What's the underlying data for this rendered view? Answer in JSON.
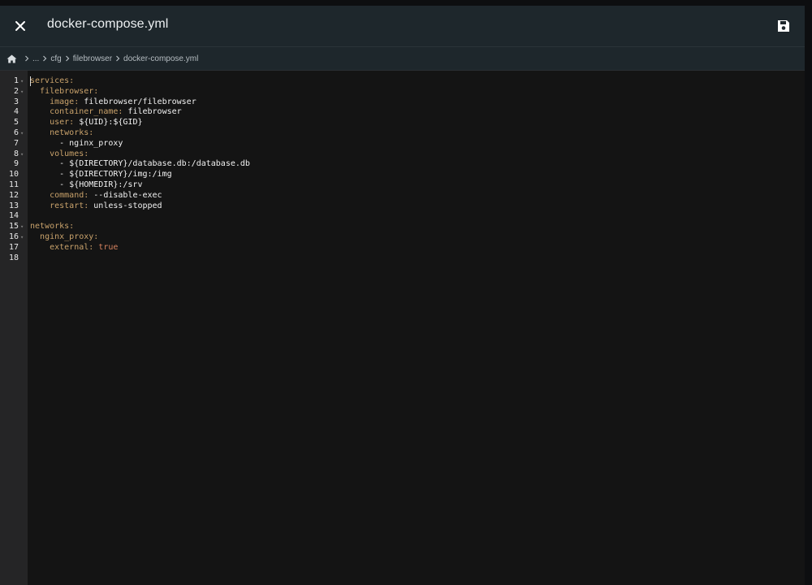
{
  "header": {
    "title": "docker-compose.yml",
    "close_icon": "close-icon",
    "save_icon": "save-icon"
  },
  "breadcrumbs": {
    "home_icon": "home-icon",
    "items": [
      "...",
      "cfg",
      "filebrowser",
      "docker-compose.yml"
    ]
  },
  "editor": {
    "language": "yaml",
    "lines": [
      {
        "n": "1",
        "fold": true,
        "indent": "",
        "key": "services",
        "sep": ":",
        "value": "",
        "vtype": ""
      },
      {
        "n": "2",
        "fold": true,
        "indent": "  ",
        "key": "filebrowser",
        "sep": ":",
        "value": "",
        "vtype": ""
      },
      {
        "n": "3",
        "fold": false,
        "indent": "    ",
        "key": "image",
        "sep": ":",
        "value": " filebrowser/filebrowser",
        "vtype": "v"
      },
      {
        "n": "4",
        "fold": false,
        "indent": "    ",
        "key": "container_name",
        "sep": ":",
        "value": " filebrowser",
        "vtype": "v"
      },
      {
        "n": "5",
        "fold": false,
        "indent": "    ",
        "key": "user",
        "sep": ":",
        "value": " ${UID}:${GID}",
        "vtype": "v"
      },
      {
        "n": "6",
        "fold": true,
        "indent": "    ",
        "key": "networks",
        "sep": ":",
        "value": "",
        "vtype": ""
      },
      {
        "n": "7",
        "fold": false,
        "indent": "      ",
        "key": "",
        "sep": "",
        "value": "- nginx_proxy",
        "vtype": "v"
      },
      {
        "n": "8",
        "fold": true,
        "indent": "    ",
        "key": "volumes",
        "sep": ":",
        "value": "",
        "vtype": ""
      },
      {
        "n": "9",
        "fold": false,
        "indent": "      ",
        "key": "",
        "sep": "",
        "value": "- ${DIRECTORY}/database.db:/database.db",
        "vtype": "v"
      },
      {
        "n": "10",
        "fold": false,
        "indent": "      ",
        "key": "",
        "sep": "",
        "value": "- ${DIRECTORY}/img:/img",
        "vtype": "v"
      },
      {
        "n": "11",
        "fold": false,
        "indent": "      ",
        "key": "",
        "sep": "",
        "value": "- ${HOMEDIR}:/srv",
        "vtype": "v"
      },
      {
        "n": "12",
        "fold": false,
        "indent": "    ",
        "key": "command",
        "sep": ":",
        "value": " --disable-exec",
        "vtype": "v"
      },
      {
        "n": "13",
        "fold": false,
        "indent": "    ",
        "key": "restart",
        "sep": ":",
        "value": " unless-stopped",
        "vtype": "v"
      },
      {
        "n": "14",
        "fold": false,
        "indent": "",
        "key": "",
        "sep": "",
        "value": "",
        "vtype": ""
      },
      {
        "n": "15",
        "fold": true,
        "indent": "",
        "key": "networks",
        "sep": ":",
        "value": "",
        "vtype": ""
      },
      {
        "n": "16",
        "fold": true,
        "indent": "  ",
        "key": "nginx_proxy",
        "sep": ":",
        "value": "",
        "vtype": ""
      },
      {
        "n": "17",
        "fold": false,
        "indent": "    ",
        "key": "external",
        "sep": ":",
        "value": " true",
        "vtype": "b"
      },
      {
        "n": "18",
        "fold": false,
        "indent": "",
        "key": "",
        "sep": "",
        "value": "",
        "vtype": ""
      }
    ]
  },
  "colors": {
    "header_bg": "#1e272c",
    "editor_bg": "#141414",
    "gutter_bg": "#252526",
    "yaml_key": "#c9a26b",
    "yaml_value": "#f2f2f2",
    "yaml_boolean": "#d6825f"
  }
}
